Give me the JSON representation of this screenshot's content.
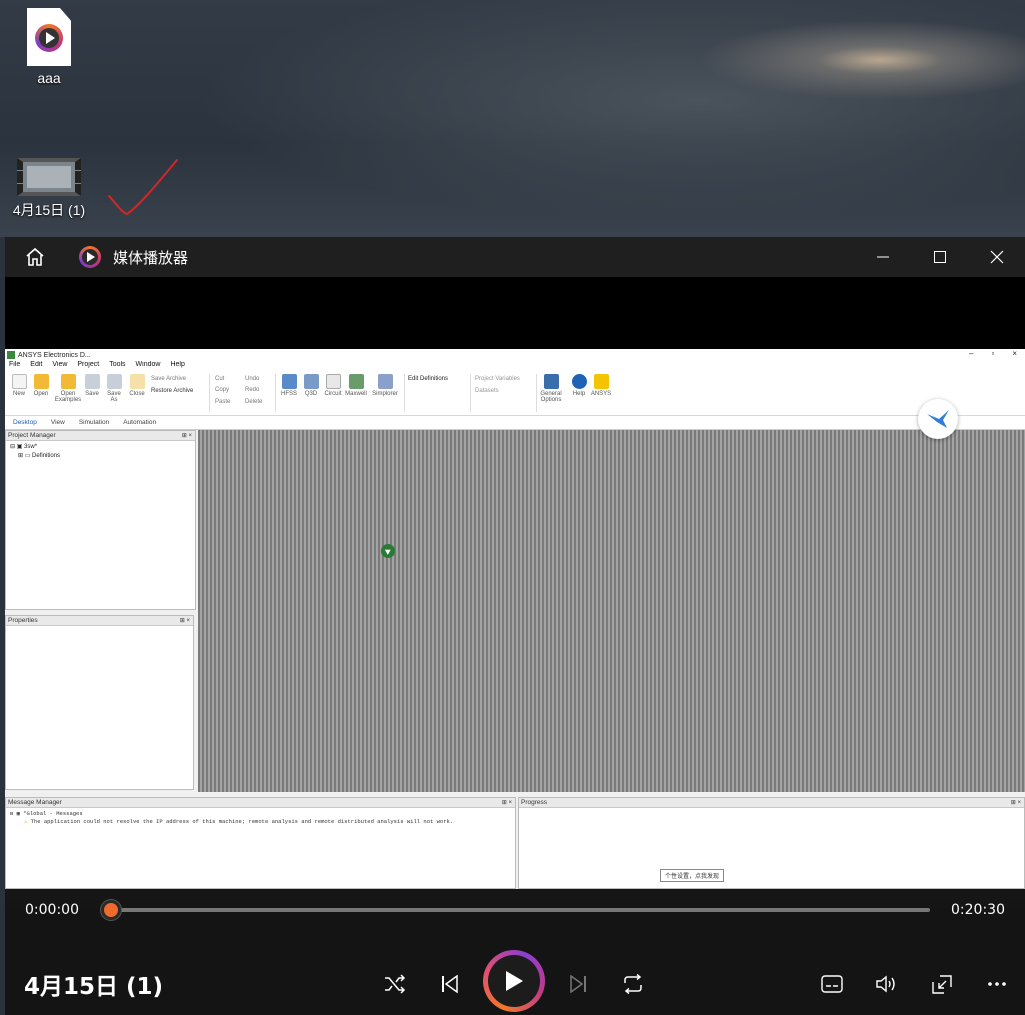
{
  "desktop": {
    "icons": [
      {
        "label": "aaa",
        "icon": "media-file-icon"
      },
      {
        "label": "4月15日 (1)",
        "icon": "video-file-icon"
      }
    ],
    "annotation": "red-checkmark"
  },
  "player": {
    "app_title": "媒体播放器",
    "media_title": "4月15日 (1)",
    "time_current": "0:00:00",
    "time_total": "0:20:30",
    "progress": 0.0,
    "accent_color": "#f06b2b"
  },
  "video_frame": {
    "window_title": "ANSYS Electronics D...",
    "menu": [
      "File",
      "Edit",
      "View",
      "Project",
      "Tools",
      "Window",
      "Help"
    ],
    "ribbon": {
      "new": "New",
      "open": "Open",
      "open_examples": "Open\nExamples",
      "save": "Save",
      "save_as": "Save\nAs",
      "close": "Close",
      "save_archive": "Save Archive",
      "restore_archive": "Restore Archive",
      "cut": "Cut",
      "copy": "Copy",
      "paste": "Paste",
      "undo": "Undo",
      "redo": "Redo",
      "delete": "Delete",
      "hfss": "HFSS",
      "q3d": "Q3D",
      "circuit": "Circuit",
      "maxwell": "Maxwell",
      "simplorer": "Simplorer",
      "edit_definitions": "Edit Definitions",
      "project_variables": "Project Variables",
      "datasets": "Datasets",
      "general_options": "General\nOptions",
      "help": "Help",
      "ansys": "ANSYS"
    },
    "tabs": [
      "Desktop",
      "View",
      "Simulation",
      "Automation"
    ],
    "project_manager": {
      "title": "Project Manager",
      "root": "3sw*",
      "child": "Definitions"
    },
    "properties_title": "Properties",
    "message_manager": {
      "title": "Message Manager",
      "group": "*Global - Messages",
      "message": "The application could not resolve the IP address of this machine; remote analysis and remote distributed analysis will not work."
    },
    "progress_title": "Progress",
    "tooltip": "个性设置，点我发现"
  }
}
